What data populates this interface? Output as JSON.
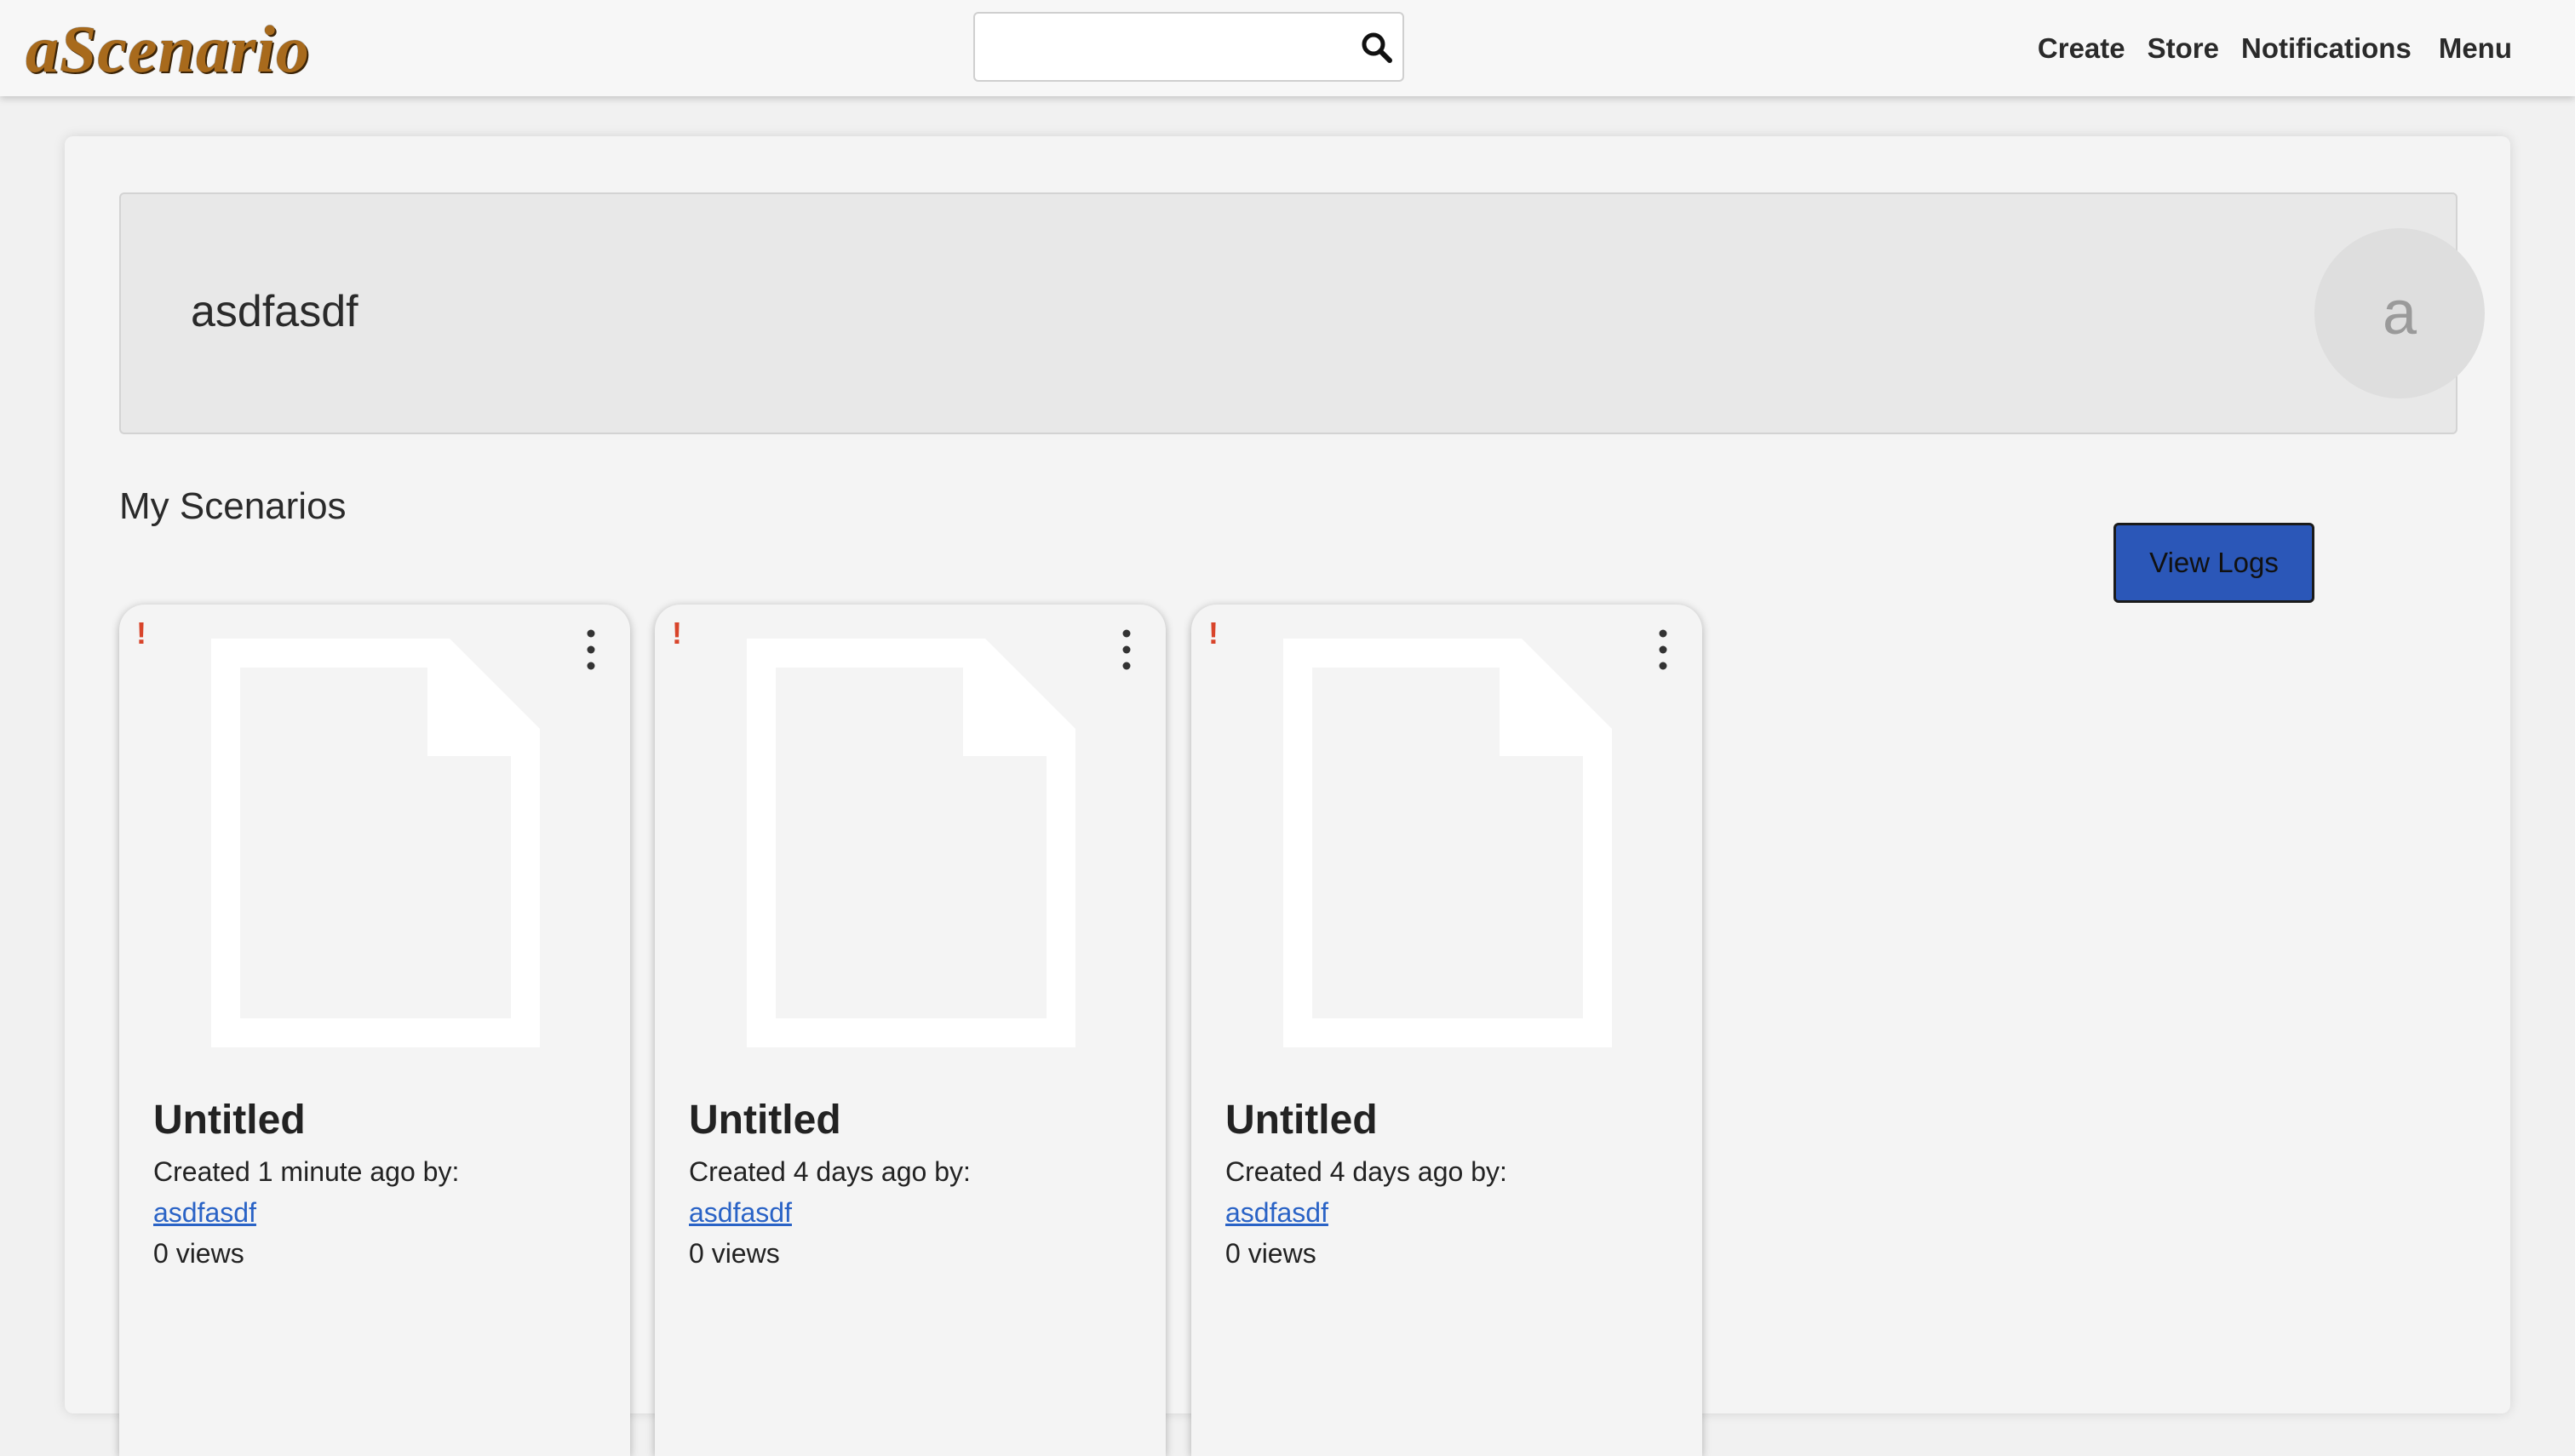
{
  "navbar": {
    "logo": "aScenario",
    "search": {
      "value": "",
      "placeholder": ""
    },
    "links": {
      "create": "Create",
      "store": "Store",
      "notifications": "Notifications",
      "menu": "Menu"
    }
  },
  "profile": {
    "name": "asdfasdf",
    "avatar_letter": "a"
  },
  "scenarios": {
    "title": "My Scenarios",
    "view_logs_label": "View Logs",
    "cards": [
      {
        "warning": "!",
        "title": "Untitled",
        "created": "Created 1 minute ago by:",
        "author": "asdfasdf",
        "views": "0 views"
      },
      {
        "warning": "!",
        "title": "Untitled",
        "created": "Created 4 days ago by:",
        "author": "asdfasdf",
        "views": "0 views"
      },
      {
        "warning": "!",
        "title": "Untitled",
        "created": "Created 4 days ago by:",
        "author": "asdfasdf",
        "views": "0 views"
      }
    ]
  },
  "icons": {
    "search": "search-icon",
    "card_menu": "more-vertical-icon",
    "thumbnail": "document-icon",
    "warning": "exclamation-icon"
  },
  "colors": {
    "button": "#2b57b8",
    "link": "#2a63c6",
    "warning": "#d8442a",
    "logo": "#a86a1c"
  }
}
